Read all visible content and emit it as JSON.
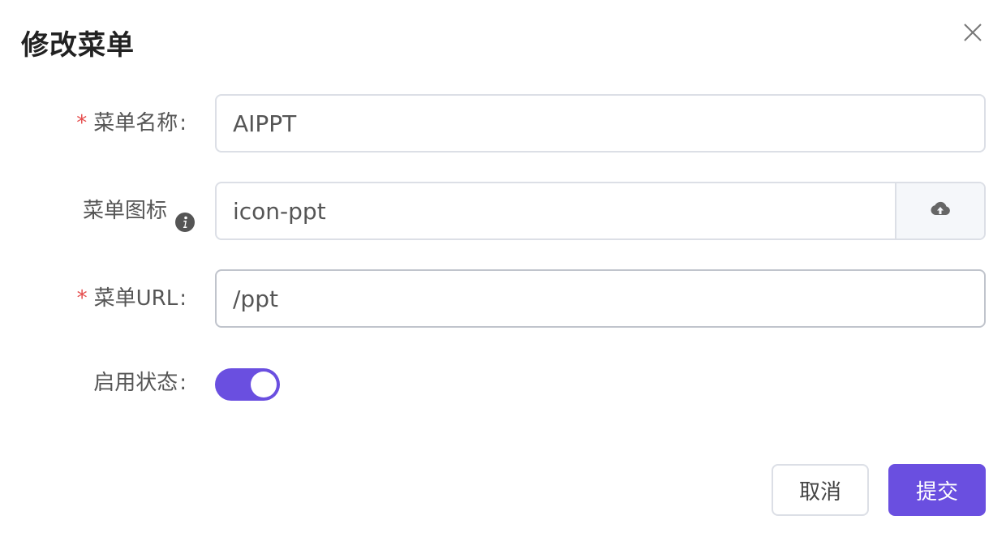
{
  "dialog": {
    "title": "修改菜单",
    "close_icon": "close-icon"
  },
  "form": {
    "menu_name": {
      "required": "*",
      "label": "菜单名称",
      "colon": ":",
      "value": "AIPPT"
    },
    "menu_icon": {
      "label": "菜单图标",
      "info_icon": "info-icon",
      "value": "icon-ppt",
      "upload_icon": "cloud-upload-icon"
    },
    "menu_url": {
      "required": "*",
      "label": "菜单URL",
      "colon": ":",
      "value": "/ppt"
    },
    "status": {
      "label": "启用状态",
      "colon": ":",
      "enabled": true
    }
  },
  "footer": {
    "cancel_label": "取消",
    "submit_label": "提交"
  },
  "colors": {
    "accent": "#6a4fe0",
    "required": "#e54d4d",
    "border": "#dcdfe6"
  }
}
